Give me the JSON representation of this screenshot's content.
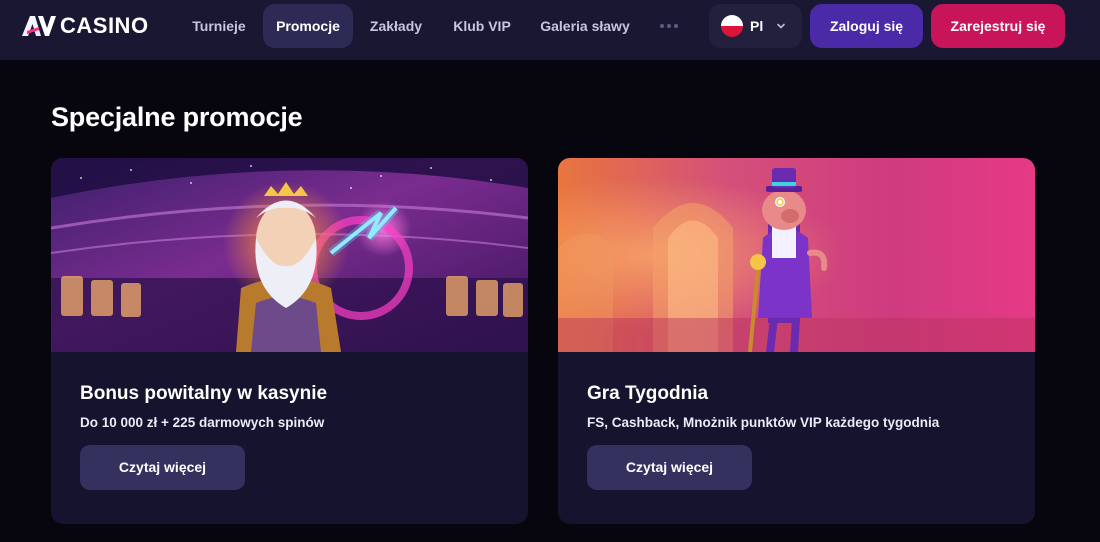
{
  "brand": {
    "logo_text": "CASINO",
    "logo_mark": "AV"
  },
  "nav": {
    "items": [
      {
        "label": "Turnieje",
        "active": false
      },
      {
        "label": "Promocje",
        "active": true
      },
      {
        "label": "Zakłady",
        "active": false
      },
      {
        "label": "Klub VIP",
        "active": false
      },
      {
        "label": "Galeria sławy",
        "active": false
      }
    ],
    "more_icon": "more-dots-icon"
  },
  "language": {
    "code": "Pl",
    "flag": "poland-flag-icon"
  },
  "auth": {
    "login_label": "Zaloguj się",
    "register_label": "Zarejestruj się"
  },
  "page": {
    "title": "Specjalne promocje"
  },
  "promotions": [
    {
      "title": "Bonus powitalny w kasynie",
      "description": "Do 10 000 zł + 225 darmowych spinów",
      "button_label": "Czytaj więcej",
      "image": "zeus-casino-banner"
    },
    {
      "title": "Gra Tygodnia",
      "description": "FS, Cashback, Mnożnik punktów VIP każdego tygodnia",
      "button_label": "Czytaj więcej",
      "image": "pig-gentleman-banner"
    }
  ],
  "colors": {
    "header_bg": "#1a1733",
    "page_bg": "#07050d",
    "card_bg": "#15132d",
    "login_btn": "#4b2aa8",
    "register_btn": "#c8155a",
    "card_btn": "#35315e",
    "active_nav": "#2d2a55"
  }
}
